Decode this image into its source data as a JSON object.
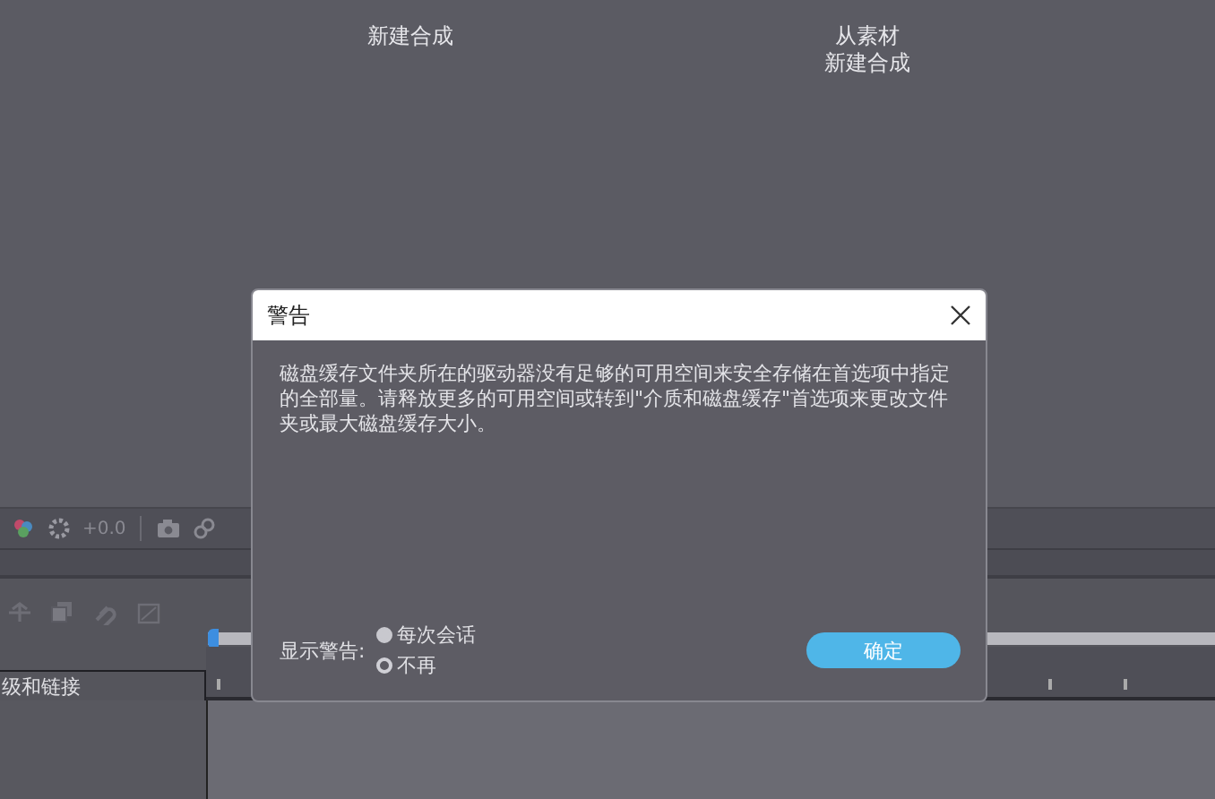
{
  "background": {
    "compositions": [
      {
        "lines": [
          "新建合成"
        ]
      },
      {
        "lines": [
          "从素材",
          "新建合成"
        ]
      }
    ]
  },
  "toolbar": {
    "exposure": "+0.0"
  },
  "layer_panel": {
    "column_header": "级和链接"
  },
  "dialog": {
    "title": "警告",
    "message": "磁盘缓存文件夹所在的驱动器没有足够的可用空间来安全存储在首选项中指定的全部量。请释放更多的可用空间或转到\"介质和磁盘缓存\"首选项来更改文件夹或最大磁盘缓存大小。",
    "show_warning": {
      "label": "显示警告:",
      "options": [
        {
          "label": "每次会话",
          "selected": true
        },
        {
          "label": "不再",
          "selected": false
        }
      ]
    },
    "buttons": [
      {
        "label": "确定"
      }
    ]
  }
}
